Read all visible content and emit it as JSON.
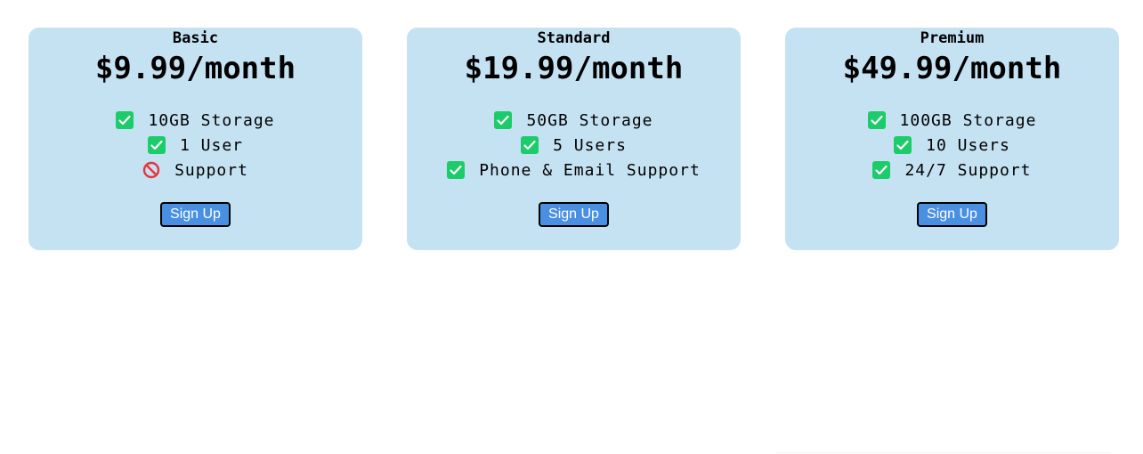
{
  "plans": [
    {
      "name": "Basic",
      "price": "$9.99/month",
      "features": [
        {
          "text": "10GB Storage",
          "icon": "check-icon",
          "included": true
        },
        {
          "text": "1 User",
          "icon": "check-icon",
          "included": true
        },
        {
          "text": "Support",
          "icon": "no-entry-icon",
          "included": false
        }
      ],
      "button_label": "Sign Up"
    },
    {
      "name": "Standard",
      "price": "$19.99/month",
      "features": [
        {
          "text": "50GB Storage",
          "icon": "check-icon",
          "included": true
        },
        {
          "text": "5 Users",
          "icon": "check-icon",
          "included": true
        },
        {
          "text": "Phone & Email Support",
          "icon": "check-icon",
          "included": true
        }
      ],
      "button_label": "Sign Up"
    },
    {
      "name": "Premium",
      "price": "$49.99/month",
      "features": [
        {
          "text": "100GB Storage",
          "icon": "check-icon",
          "included": true
        },
        {
          "text": "10 Users",
          "icon": "check-icon",
          "included": true
        },
        {
          "text": "24/7 Support",
          "icon": "check-icon",
          "included": true
        }
      ],
      "button_label": "Sign Up"
    }
  ],
  "colors": {
    "card_background": "#c5e2f3",
    "check": "#1ccc6a",
    "no_entry": "#e8333a",
    "button": "#4a90e2"
  }
}
